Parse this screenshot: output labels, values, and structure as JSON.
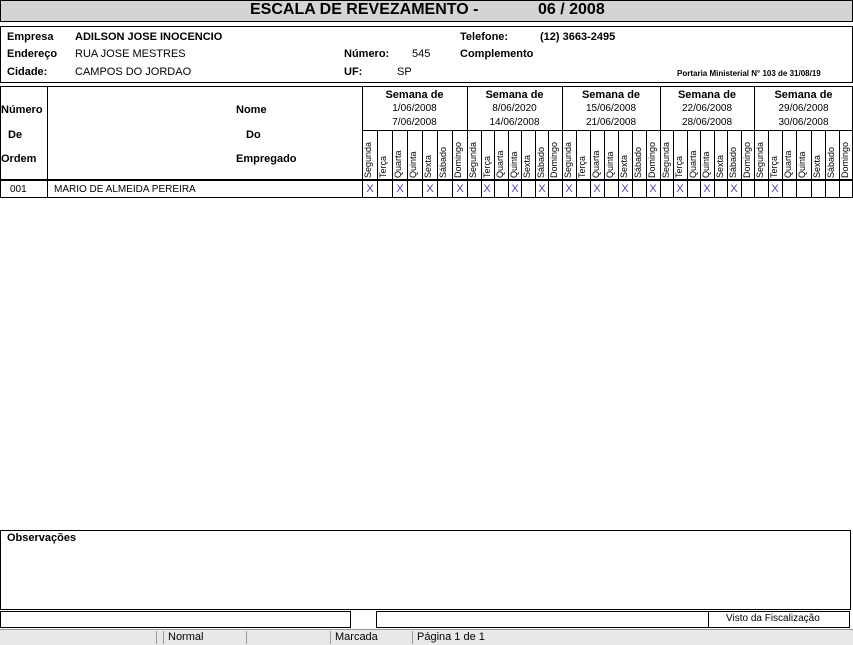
{
  "report": {
    "title": "ESCALA DE REVEZAMENTO -",
    "period": "06 / 2008"
  },
  "company": {
    "empresa_label": "Empresa",
    "empresa_value": "ADILSON JOSE INOCENCIO",
    "telefone_label": "Telefone:",
    "telefone_value": "(12) 3663-2495",
    "endereco_label": "Endereço",
    "endereco_value": "RUA JOSE MESTRES",
    "numero_label": "Número:",
    "numero_value": "545",
    "complemento_label": "Complemento",
    "cidade_label": "Cidade:",
    "cidade_value": "CAMPOS DO JORDAO",
    "uf_label": "UF:",
    "uf_value": "SP",
    "portaria": "Portaria Ministerial N° 103 de 31/08/19"
  },
  "table_header": {
    "numero": "Número",
    "de": "De",
    "ordem": "Ordem",
    "nome": "Nome",
    "do": "Do",
    "empregado": "Empregado"
  },
  "weeks": [
    {
      "label": "Semana de",
      "start": "1/06/2008",
      "end": "7/06/2008"
    },
    {
      "label": "Semana de",
      "start": "8/06/2020",
      "end": "14/06/2008"
    },
    {
      "label": "Semana de",
      "start": "15/06/2008",
      "end": "21/06/2008"
    },
    {
      "label": "Semana de",
      "start": "22/06/2008",
      "end": "28/06/2008"
    },
    {
      "label": "Semana de",
      "start": "29/06/2008",
      "end": "30/06/2008"
    }
  ],
  "days": [
    "Segunda",
    "Terça",
    "Quarta",
    "Quinta",
    "Sexta",
    "Sábado",
    "Domingo"
  ],
  "employees": [
    {
      "order": "001",
      "name": "MARIO DE ALMEIDA PEREIRA",
      "marks": [
        1,
        0,
        1,
        0,
        1,
        0,
        1,
        0,
        1,
        0,
        1,
        0,
        1,
        0,
        1,
        0,
        1,
        0,
        1,
        0,
        1,
        0,
        1,
        0,
        1,
        0,
        1,
        0,
        0,
        1,
        0,
        0,
        0,
        0,
        0
      ]
    }
  ],
  "mark_symbol": "X",
  "mark_color": "#3a49b8",
  "observacoes_label": "Observações",
  "visto_label": "Visto da Fiscalização",
  "statusbar": {
    "mode": "Normal",
    "marcada": "Marcada",
    "pagina": "Página 1 de 1"
  }
}
